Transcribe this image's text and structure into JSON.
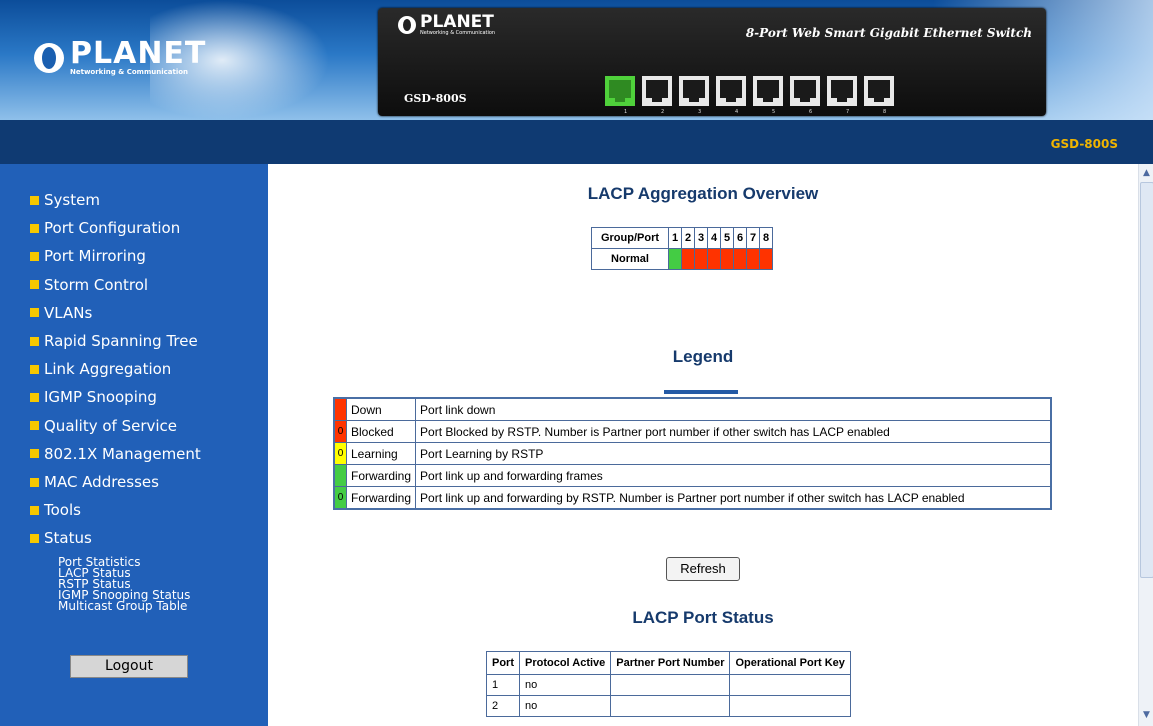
{
  "header": {
    "brand": "PLANET",
    "brand_tagline": "Networking & Communication",
    "switch_title": "8-Port Web Smart Gigabit Ethernet Switch",
    "switch_model": "GSD-800S",
    "port_numbers": [
      "1",
      "2",
      "3",
      "4",
      "5",
      "6",
      "7",
      "8"
    ]
  },
  "topbar": {
    "model": "GSD-800S"
  },
  "sidebar": {
    "items": [
      {
        "label": "System"
      },
      {
        "label": "Port Configuration"
      },
      {
        "label": "Port Mirroring"
      },
      {
        "label": "Storm Control"
      },
      {
        "label": "VLANs"
      },
      {
        "label": "Rapid Spanning Tree"
      },
      {
        "label": "Link Aggregation"
      },
      {
        "label": "IGMP Snooping"
      },
      {
        "label": "Quality of Service"
      },
      {
        "label": "802.1X Management"
      },
      {
        "label": "MAC Addresses"
      },
      {
        "label": "Tools"
      },
      {
        "label": "Status"
      }
    ],
    "status_subitems": [
      {
        "label": "Port Statistics"
      },
      {
        "label": "LACP Status"
      },
      {
        "label": "RSTP Status"
      },
      {
        "label": "IGMP Snooping Status"
      },
      {
        "label": "Multicast Group Table"
      }
    ],
    "logout_label": "Logout"
  },
  "main": {
    "overview_title": "LACP Aggregation Overview",
    "aggregation": {
      "header_label": "Group/Port",
      "ports": [
        "1",
        "2",
        "3",
        "4",
        "5",
        "6",
        "7",
        "8"
      ],
      "row_label": "Normal",
      "port_states": [
        "up",
        "down",
        "down",
        "down",
        "down",
        "down",
        "down",
        "down"
      ]
    },
    "legend_title": "Legend",
    "legend": [
      {
        "marker": "",
        "color": "#ff3300",
        "state": "Down",
        "desc": "Port link down"
      },
      {
        "marker": "0",
        "color": "#ff3300",
        "state": "Blocked",
        "desc": "Port Blocked by RSTP. Number is Partner port number if other switch has LACP enabled"
      },
      {
        "marker": "0",
        "color": "#ffff00",
        "state": "Learning",
        "desc": "Port Learning by RSTP"
      },
      {
        "marker": "",
        "color": "#44cc44",
        "state": "Forwarding",
        "desc": "Port link up and forwarding frames"
      },
      {
        "marker": "0",
        "color": "#44cc44",
        "state": "Forwarding",
        "desc": "Port link up and forwarding by RSTP. Number is Partner port number if other switch has LACP enabled"
      }
    ],
    "refresh_label": "Refresh",
    "port_status_title": "LACP Port Status",
    "port_status": {
      "headers": [
        "Port",
        "Protocol Active",
        "Partner Port Number",
        "Operational Port Key"
      ],
      "rows": [
        [
          "1",
          "no",
          "",
          ""
        ],
        [
          "2",
          "no",
          "",
          ""
        ]
      ]
    }
  },
  "colors": {
    "down": "#ff3300",
    "up": "#44cc44",
    "sidebar": "#2160b8",
    "accent": "#f0b400"
  }
}
